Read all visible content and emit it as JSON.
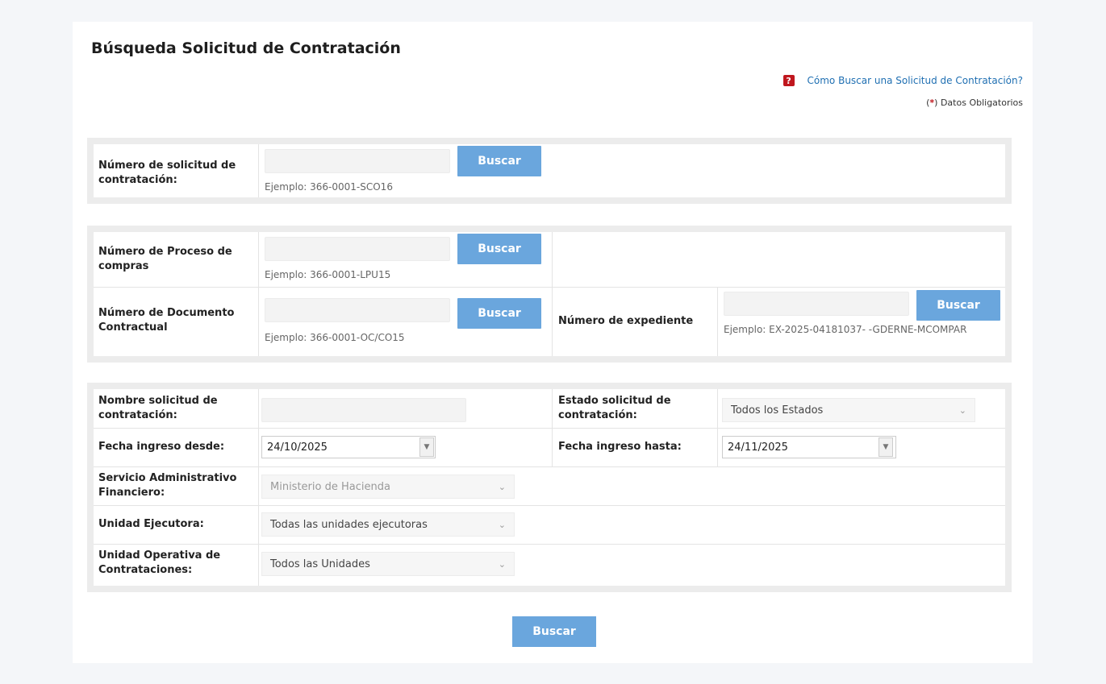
{
  "page": {
    "title": "Búsqueda Solicitud de Contratación",
    "help_link": "Cómo Buscar una Solicitud de Contratación?",
    "help_icon": "?",
    "required_open": "(",
    "required_star": "*",
    "required_text": ") Datos Obligatorios"
  },
  "section1": {
    "solicitud_label": "Número de solicitud de contratación:",
    "solicitud_value": "",
    "solicitud_hint": "Ejemplo: 366-0001-SCO16",
    "buscar_label": "Buscar"
  },
  "section2": {
    "proceso_label": "Número de Proceso de compras",
    "proceso_value": "",
    "proceso_hint": "Ejemplo: 366-0001-LPU15",
    "documento_label": "Número de Documento Contractual",
    "documento_value": "",
    "documento_hint": "Ejemplo: 366-0001-OC/CO15",
    "expediente_label": "Número de expediente",
    "expediente_value": "",
    "expediente_hint": "Ejemplo: EX-2025-04181037- -GDERNE-MCOMPAR",
    "buscar_label": "Buscar"
  },
  "section3": {
    "nombre_label": "Nombre solicitud de contratación:",
    "nombre_value": "",
    "estado_label": "Estado solicitud de contratación:",
    "estado_value": "Todos los Estados",
    "fecha_desde_label": "Fecha ingreso desde:",
    "fecha_desde_value": "24/10/2025",
    "fecha_hasta_label": "Fecha ingreso hasta:",
    "fecha_hasta_value": "24/11/2025",
    "saf_label": "Servicio Administrativo Financiero:",
    "saf_value": "Ministerio de Hacienda",
    "unidad_ejecutora_label": "Unidad Ejecutora:",
    "unidad_ejecutora_value": "Todas las unidades ejecutoras",
    "uoc_label": "Unidad Operativa de Contrataciones:",
    "uoc_value": "Todos las Unidades"
  },
  "footer": {
    "buscar_label": "Buscar"
  },
  "colors": {
    "button": "#6aa6dd",
    "link": "#1f6fb2",
    "help_icon": "#c0171e"
  }
}
